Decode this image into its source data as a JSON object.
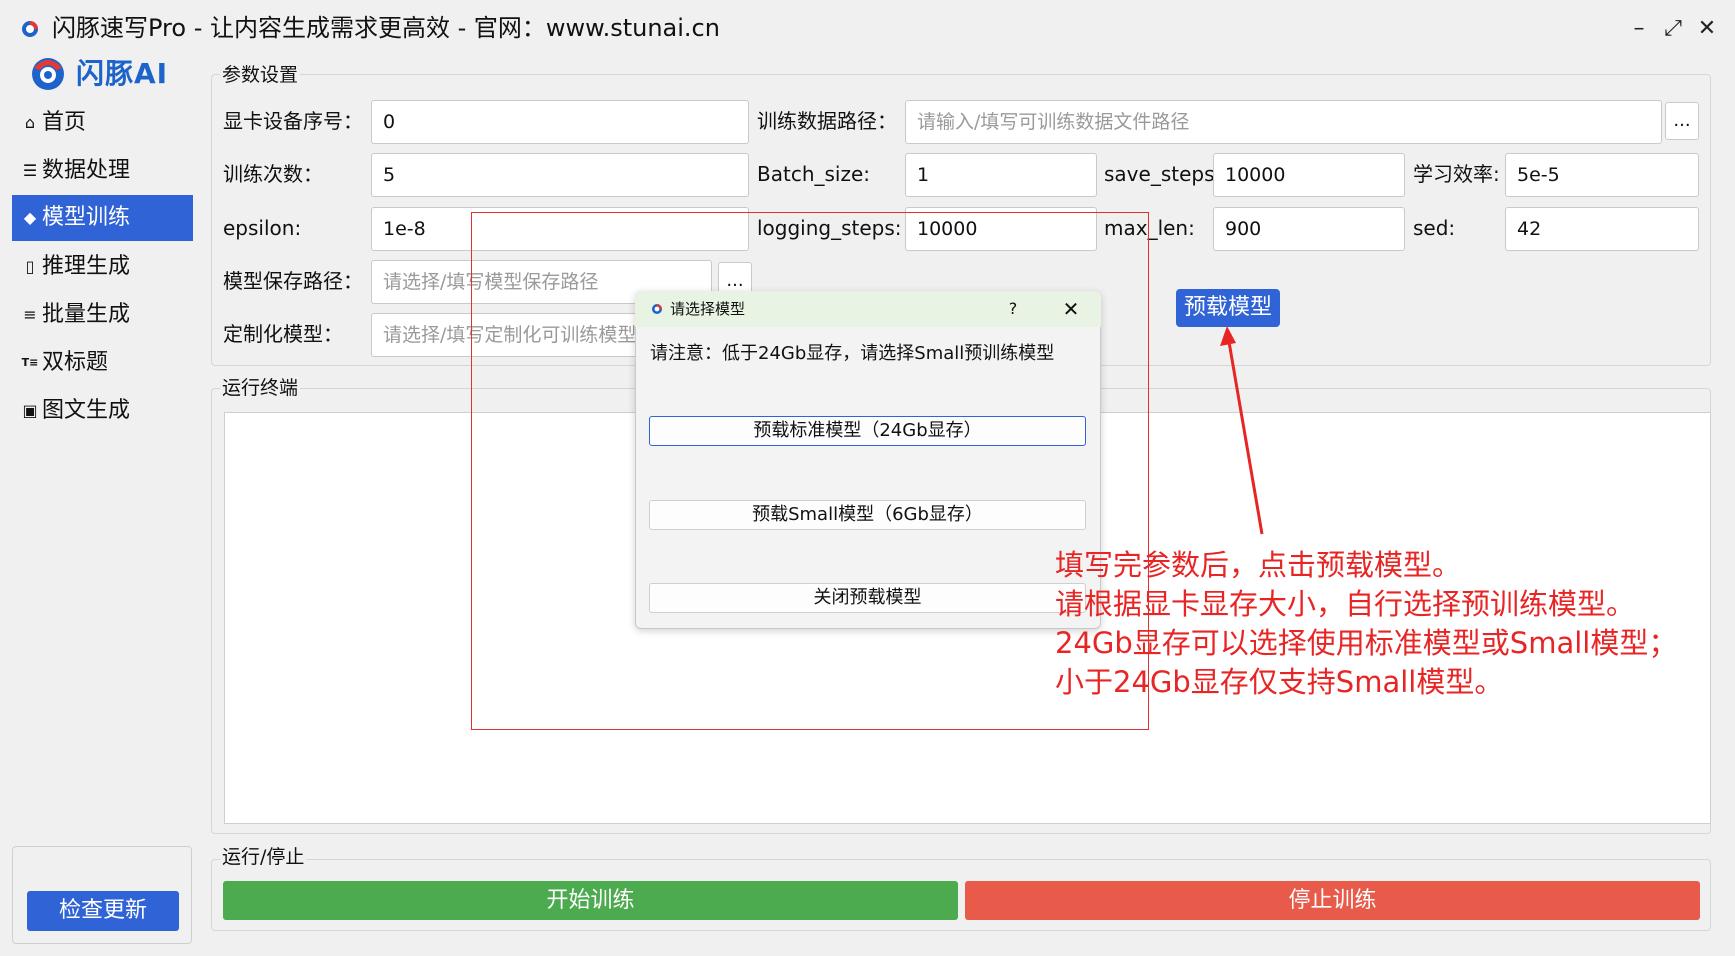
{
  "window": {
    "title": "闪豚速写Pro - 让内容生成需求更高效  -  官网：www.stunai.cn",
    "controls": [
      "–",
      "⤢",
      "✕"
    ]
  },
  "logo": {
    "text": "闪豚AI",
    "color": "#1d63c9"
  },
  "sidebar": {
    "items": [
      {
        "label": "首页",
        "icon": "home-icon",
        "active": false
      },
      {
        "label": "数据处理",
        "icon": "database-icon",
        "active": false
      },
      {
        "label": "模型训练",
        "icon": "cube-icon",
        "active": true
      },
      {
        "label": "推理生成",
        "icon": "document-icon",
        "active": false
      },
      {
        "label": "批量生成",
        "icon": "list-add-icon",
        "active": false
      },
      {
        "label": "双标题",
        "icon": "title-icon",
        "active": false
      },
      {
        "label": "图文生成",
        "icon": "image-icon",
        "active": false
      }
    ],
    "update_button": "检查更新"
  },
  "params": {
    "group_title": "参数设置",
    "gpu_label": "显卡设备序号：",
    "gpu_value": "0",
    "train_path_label": "训练数据路径：",
    "train_path_placeholder": "请输入/填写可训练数据文件路径",
    "epochs_label": "训练次数：",
    "epochs_value": "5",
    "batch_label": "Batch_size:",
    "batch_value": "1",
    "save_steps_label": "save_steps:",
    "save_steps_value": "10000",
    "lr_label": "学习效率:",
    "lr_value": "5e-5",
    "epsilon_label": "epsilon:",
    "epsilon_value": "1e-8",
    "logging_label": "logging_steps:",
    "logging_value": "10000",
    "maxlen_label": "max_len:",
    "maxlen_value": "900",
    "sed_label": "sed:",
    "sed_value": "42",
    "save_path_label": "模型保存路径：",
    "save_path_placeholder": "请选择/填写模型保存路径",
    "custom_label": "定制化模型：",
    "custom_placeholder": "请选择/填写定制化可训练模型",
    "browse": "...",
    "preload_button": "预载模型"
  },
  "terminal": {
    "group_title": "运行终端"
  },
  "run": {
    "group_title": "运行/停止",
    "start_button": "开始训练",
    "stop_button": "停止训练",
    "start_color": "#4caa4f",
    "stop_color": "#e85a4a"
  },
  "dialog": {
    "title": "请选择模型",
    "help": "?",
    "close": "✕",
    "note": "请注意：低于24Gb显存，请选择Small预训练模型",
    "btn_standard": "预载标准模型（24Gb显存）",
    "btn_small": "预载Small模型（6Gb显存）",
    "btn_close": "关闭预载模型"
  },
  "annotation": {
    "lines": [
      "填写完参数后，点击预载模型。",
      "请根据显卡显存大小，自行选择预训练模型。",
      "24Gb显存可以选择使用标准模型或Small模型；",
      "小于24Gb显存仅支持Small模型。"
    ],
    "color": "#e82525"
  }
}
